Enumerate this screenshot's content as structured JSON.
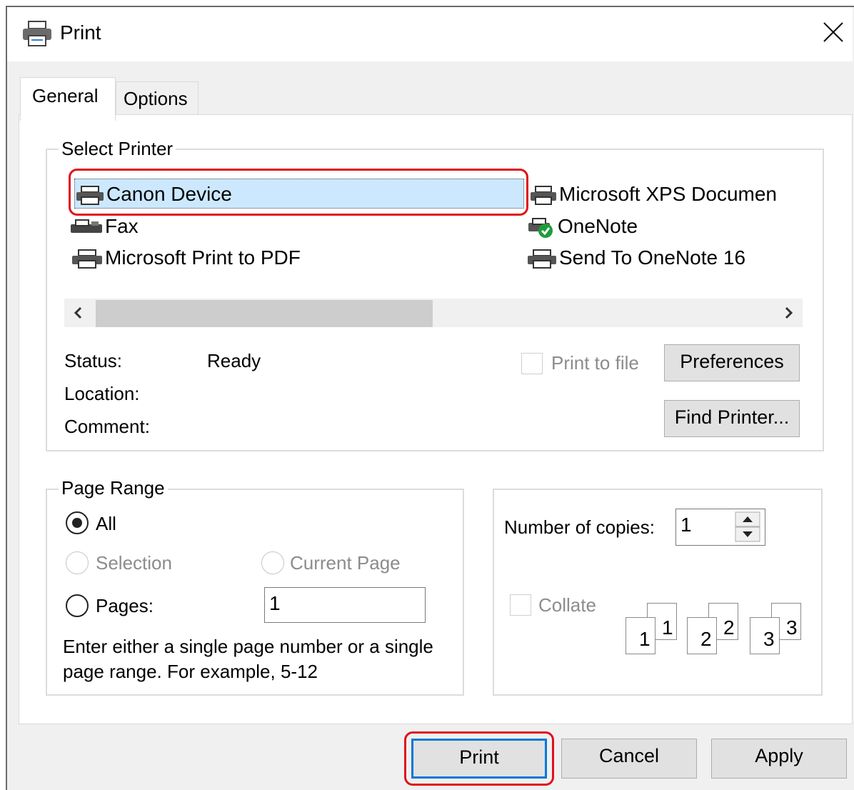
{
  "window": {
    "title": "Print",
    "close_glyph": "✕"
  },
  "tabs": [
    {
      "label": "General"
    },
    {
      "label": "Options"
    }
  ],
  "select_printer": {
    "legend": "Select Printer",
    "printers": [
      {
        "label": "Canon Device",
        "icon": "printer-icon"
      },
      {
        "label": "Fax",
        "icon": "fax-icon"
      },
      {
        "label": "Microsoft Print to PDF",
        "icon": "printer-icon"
      },
      {
        "label": "Microsoft XPS Documen",
        "icon": "printer-icon"
      },
      {
        "label": "OneNote",
        "icon": "printer-default-icon"
      },
      {
        "label": "Send To OneNote 16",
        "icon": "printer-icon"
      }
    ],
    "selected": "Canon Device",
    "status_label": "Status:",
    "status_value": "Ready",
    "location_label": "Location:",
    "comment_label": "Comment:",
    "print_to_file_label": "Print to file",
    "preferences_label": "Preferences",
    "find_printer_label": "Find Printer..."
  },
  "page_range": {
    "legend": "Page Range",
    "all_label": "All",
    "selection_label": "Selection",
    "current_page_label": "Current Page",
    "pages_label": "Pages:",
    "pages_value": "1",
    "help_line1": "Enter either a single page number or a single",
    "help_line2": "page range.  For example, 5-12",
    "selected": "All"
  },
  "copies": {
    "label": "Number of copies:",
    "value": "1",
    "collate_label": "Collate",
    "collate_numbers": [
      "1",
      "1",
      "2",
      "2",
      "3",
      "3"
    ]
  },
  "buttons": {
    "print": "Print",
    "cancel": "Cancel",
    "apply": "Apply"
  },
  "colors": {
    "highlight": "#e0111b",
    "selection": "#cce8ff",
    "default_button_border": "#0078d7"
  }
}
